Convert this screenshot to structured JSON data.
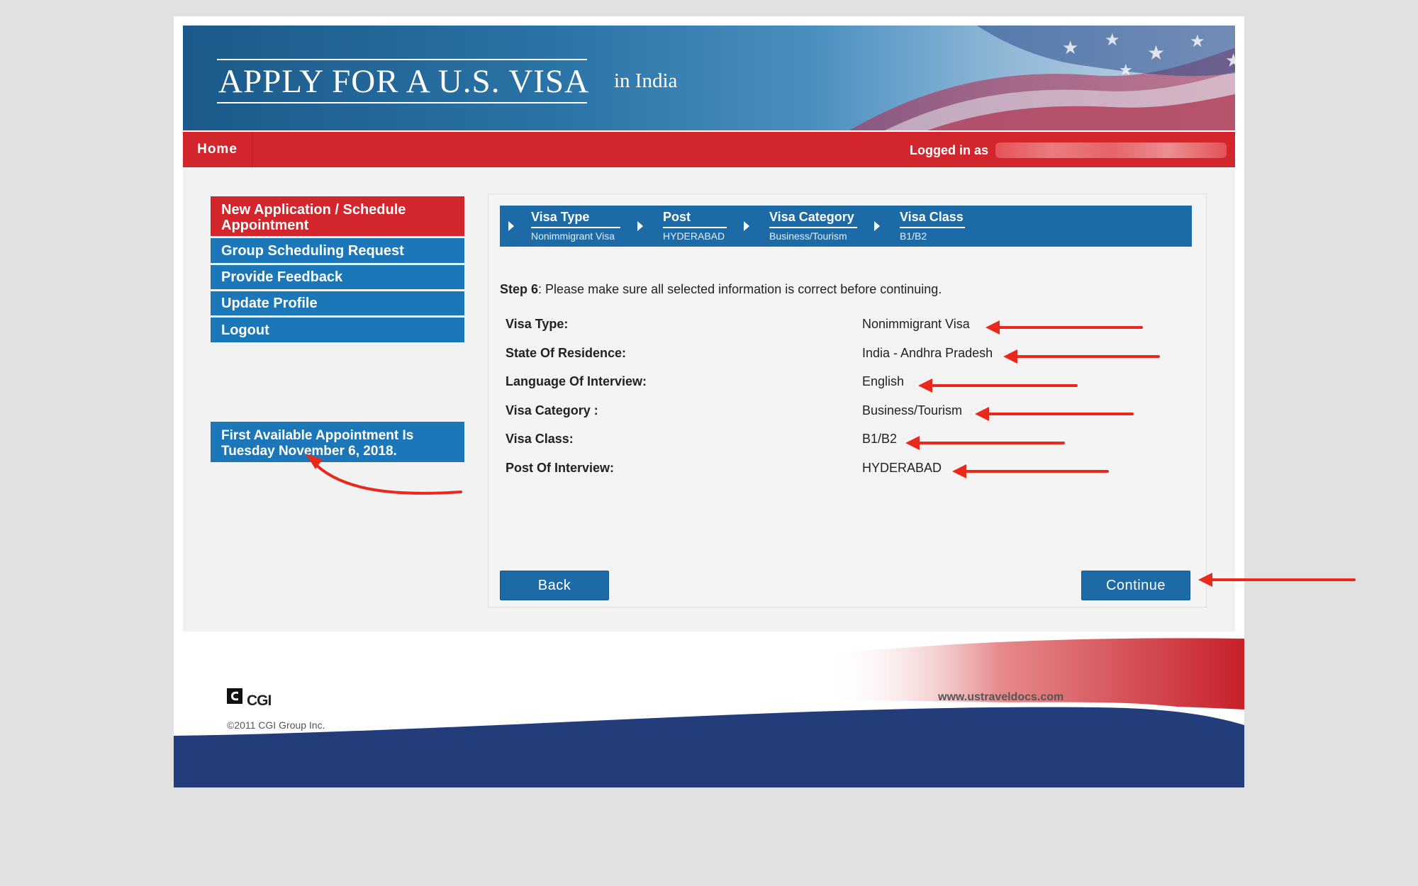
{
  "banner": {
    "title": "APPLY FOR A U.S. VISA",
    "subtitle": "in  India"
  },
  "nav": {
    "home": "Home",
    "logged_in_label": "Logged in as"
  },
  "sidebar": {
    "items": [
      {
        "label": "New Application / Schedule Appointment",
        "active": true
      },
      {
        "label": "Group Scheduling Request"
      },
      {
        "label": "Provide Feedback"
      },
      {
        "label": "Update Profile"
      },
      {
        "label": "Logout"
      }
    ],
    "appointment_notice": "First Available Appointment Is Tuesday November 6, 2018."
  },
  "breadcrumb": {
    "steps": [
      {
        "title": "Visa Type",
        "value": "Nonimmigrant Visa"
      },
      {
        "title": "Post",
        "value": "HYDERABAD"
      },
      {
        "title": "Visa Category",
        "value": "Business/Tourism"
      },
      {
        "title": "Visa Class",
        "value": "B1/B2"
      }
    ]
  },
  "step": {
    "label": "Step 6",
    "text": ": Please make sure all selected information is correct before continuing."
  },
  "summary": {
    "rows": [
      {
        "label": "Visa Type:",
        "value": "Nonimmigrant Visa"
      },
      {
        "label": "State Of Residence:",
        "value": "India - Andhra Pradesh"
      },
      {
        "label": "Language Of Interview:",
        "value": "English"
      },
      {
        "label": "Visa Category :",
        "value": "Business/Tourism"
      },
      {
        "label": "Visa Class:",
        "value": "B1/B2"
      },
      {
        "label": "Post Of Interview:",
        "value": "HYDERABAD"
      }
    ]
  },
  "buttons": {
    "back": "Back",
    "continue": "Continue"
  },
  "footer": {
    "logo_text": "CGI",
    "copyright": "©2011 CGI Group Inc.",
    "url": "www.ustraveldocs.com"
  },
  "colors": {
    "brand_blue": "#1c6aa6",
    "brand_red": "#d2262c",
    "annotation_red": "#e8291c"
  }
}
